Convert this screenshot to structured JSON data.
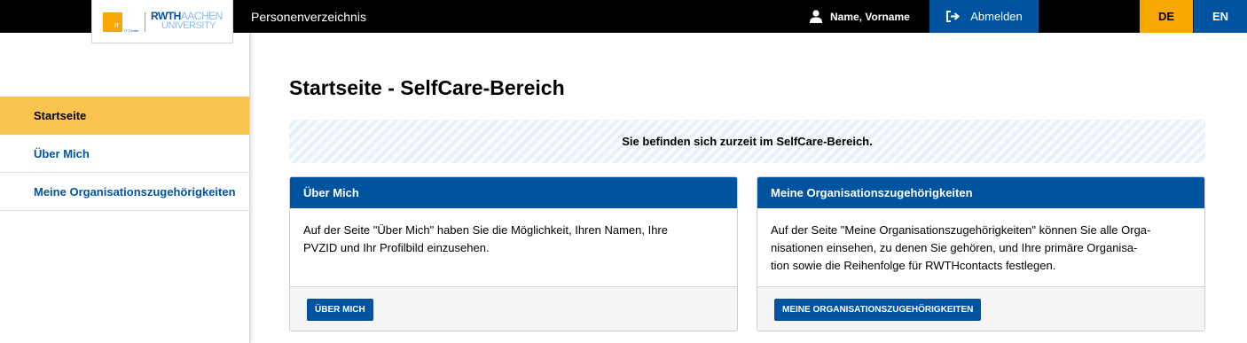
{
  "header": {
    "logo_it_letters": "IT",
    "logo_it_sub": "IT Center",
    "logo_rwth": "RWTH",
    "logo_aachen": "AACHEN",
    "logo_university": "UNIVERSITY",
    "app_title": "Personenverzeichnis",
    "user_name": "Name, Vorname",
    "logout_label": "Abmelden",
    "lang_de": "DE",
    "lang_en": "EN"
  },
  "sidebar": {
    "items": [
      {
        "label": "Startseite",
        "active": true
      },
      {
        "label": "Über Mich",
        "active": false
      },
      {
        "label": "Meine Organisationszugehörigkeiten",
        "active": false
      }
    ]
  },
  "main": {
    "title": "Startseite - SelfCare-Bereich",
    "info": "Sie befinden sich zurzeit im SelfCare-Bereich.",
    "cards": [
      {
        "heading": "Über Mich",
        "body_lines": [
          "Auf der Seite \"Über Mich\" haben Sie die Möglichkeit, Ihren Namen, Ihre",
          "PVZID und Ihr Profilbild einzusehen."
        ],
        "button": "ÜBER MICH"
      },
      {
        "heading": "Meine Organisationszugehörigkeiten",
        "body_lines": [
          "Auf der Seite \"Meine Organisationszugehörigkeiten\" können Sie alle Orga-",
          "nisationen einsehen, zu denen Sie gehören, und Ihre primäre Organisa-",
          "tion sowie die Reihenfolge für RWTHcontacts festlegen."
        ],
        "button": "MEINE ORGANISATIONSZUGEHÖRIGKEITEN"
      }
    ]
  },
  "colors": {
    "brand_blue": "#00549f",
    "accent_yellow": "#f6a800",
    "active_nav": "#f8c44f",
    "topbar": "#000000"
  },
  "icons": {
    "user": "user-icon",
    "logout": "sign-out-icon"
  }
}
